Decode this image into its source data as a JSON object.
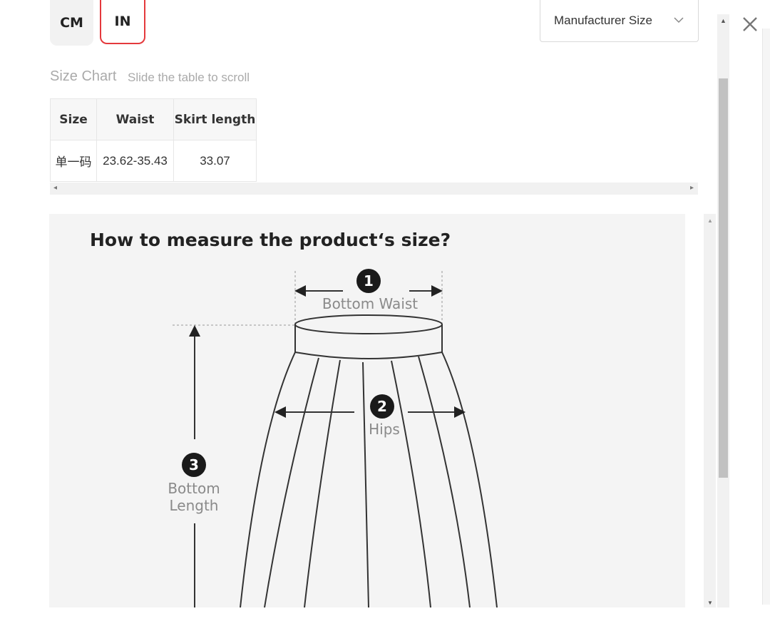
{
  "units": {
    "cm_label": "CM",
    "in_label": "IN",
    "selected": "IN"
  },
  "size_select": {
    "value": "Manufacturer Size"
  },
  "size_chart": {
    "title": "Size Chart",
    "hint": "Slide the table to scroll",
    "columns": [
      "Size",
      "Waist",
      "Skirt length"
    ],
    "rows": [
      [
        "单一码",
        "23.62-35.43",
        "33.07"
      ]
    ]
  },
  "guide": {
    "title": "How to measure the product‘s size?",
    "waist_num": "1",
    "waist_label": "Bottom Waist",
    "hips_num": "2",
    "hips_label": "Hips",
    "length_num": "3",
    "length_label_1": "Bottom",
    "length_label_2": "Length"
  },
  "icons": {
    "close": "close-icon",
    "chevron": "chevron-down-icon",
    "scroll_up": "arrow-up-icon",
    "scroll_down": "arrow-down-icon"
  },
  "colors": {
    "accent": "#e4393c"
  }
}
